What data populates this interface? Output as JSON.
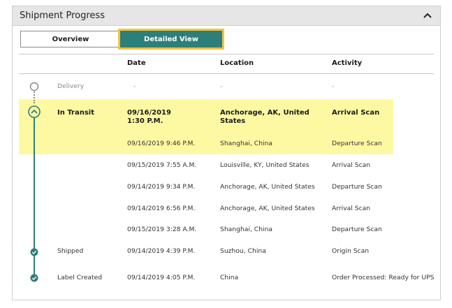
{
  "panel": {
    "title": "Shipment Progress",
    "collapse_icon": "chevron-up-icon"
  },
  "tabs": {
    "overview": "Overview",
    "detailed": "Detailed View"
  },
  "table": {
    "headers": {
      "date": "Date",
      "location": "Location",
      "activity": "Activity"
    },
    "delivery": {
      "label": "Delivery",
      "date": "-",
      "location": "-",
      "activity": "-"
    },
    "current": {
      "status": "In Transit",
      "date_line1": "09/16/2019",
      "date_line2": "1:30 P.M.",
      "location_line1": "Anchorage, AK, United",
      "location_line2": "States",
      "activity": "Arrival Scan"
    },
    "rows": [
      {
        "status": "",
        "date": "09/16/2019  9:46 P.M.",
        "location": "Shanghai, China",
        "activity": "Departure Scan"
      },
      {
        "status": "",
        "date": "09/15/2019  7:55 A.M.",
        "location": "Louisville, KY, United States",
        "activity": "Arrival Scan"
      },
      {
        "status": "",
        "date": "09/14/2019  9:34 P.M.",
        "location": "Anchorage, AK, United States",
        "activity": "Departure Scan"
      },
      {
        "status": "",
        "date": "09/14/2019  6:56 P.M.",
        "location": "Anchorage, AK, United States",
        "activity": "Arrival Scan"
      },
      {
        "status": "",
        "date": "09/15/2019  3:28 A.M.",
        "location": "Shanghai, China",
        "activity": "Departure Scan"
      },
      {
        "status": "Shipped",
        "date": "09/14/2019  4:39 P.M.",
        "location": "Suzhou, China",
        "activity": "Origin Scan"
      },
      {
        "status": "Label Created",
        "date": "09/14/2019  4:05 P.M.",
        "location": "China",
        "activity": "Order Processed: Ready for UPS"
      }
    ]
  },
  "colors": {
    "accent": "#2d7f79",
    "highlight": "#fdf9a2",
    "focus_outline": "#f6c23e"
  }
}
